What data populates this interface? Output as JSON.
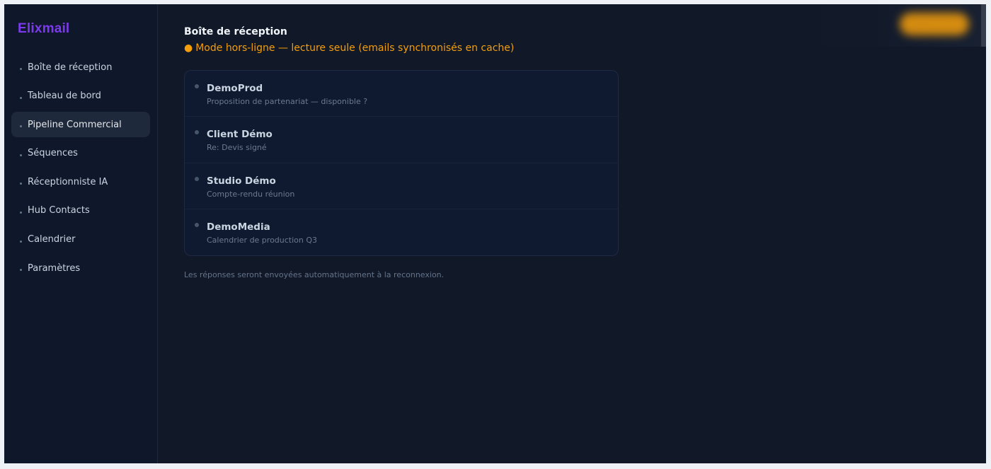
{
  "app": {
    "name": "Elixmail"
  },
  "sidebar": {
    "items": [
      {
        "label": "Boîte de réception",
        "active": false
      },
      {
        "label": "Tableau de bord",
        "active": false
      },
      {
        "label": "Pipeline Commercial",
        "active": true
      },
      {
        "label": "Séquences",
        "active": false
      },
      {
        "label": "Réceptionniste IA",
        "active": false
      },
      {
        "label": "Hub Contacts",
        "active": false
      },
      {
        "label": "Calendrier",
        "active": false
      },
      {
        "label": "Paramètres",
        "active": false
      }
    ]
  },
  "main": {
    "title": "Boîte de réception",
    "offline_dot": "●",
    "offline_text": "Mode hors-ligne — lecture seule (emails synchronisés en cache)",
    "emails": [
      {
        "sender": "DemoProd",
        "subject": "Proposition de partenariat — disponible ?"
      },
      {
        "sender": "Client Démo",
        "subject": "Re: Devis signé"
      },
      {
        "sender": "Studio Démo",
        "subject": "Compte-rendu réunion"
      },
      {
        "sender": "DemoMedia",
        "subject": "Calendrier de production Q3"
      }
    ],
    "footnote": "Les réponses seront envoyées automatiquement à la reconnexion."
  },
  "colors": {
    "brand": "#7c3aed",
    "warning": "#f59e0b",
    "background": "#111827",
    "sidebar": "#0f172a"
  }
}
